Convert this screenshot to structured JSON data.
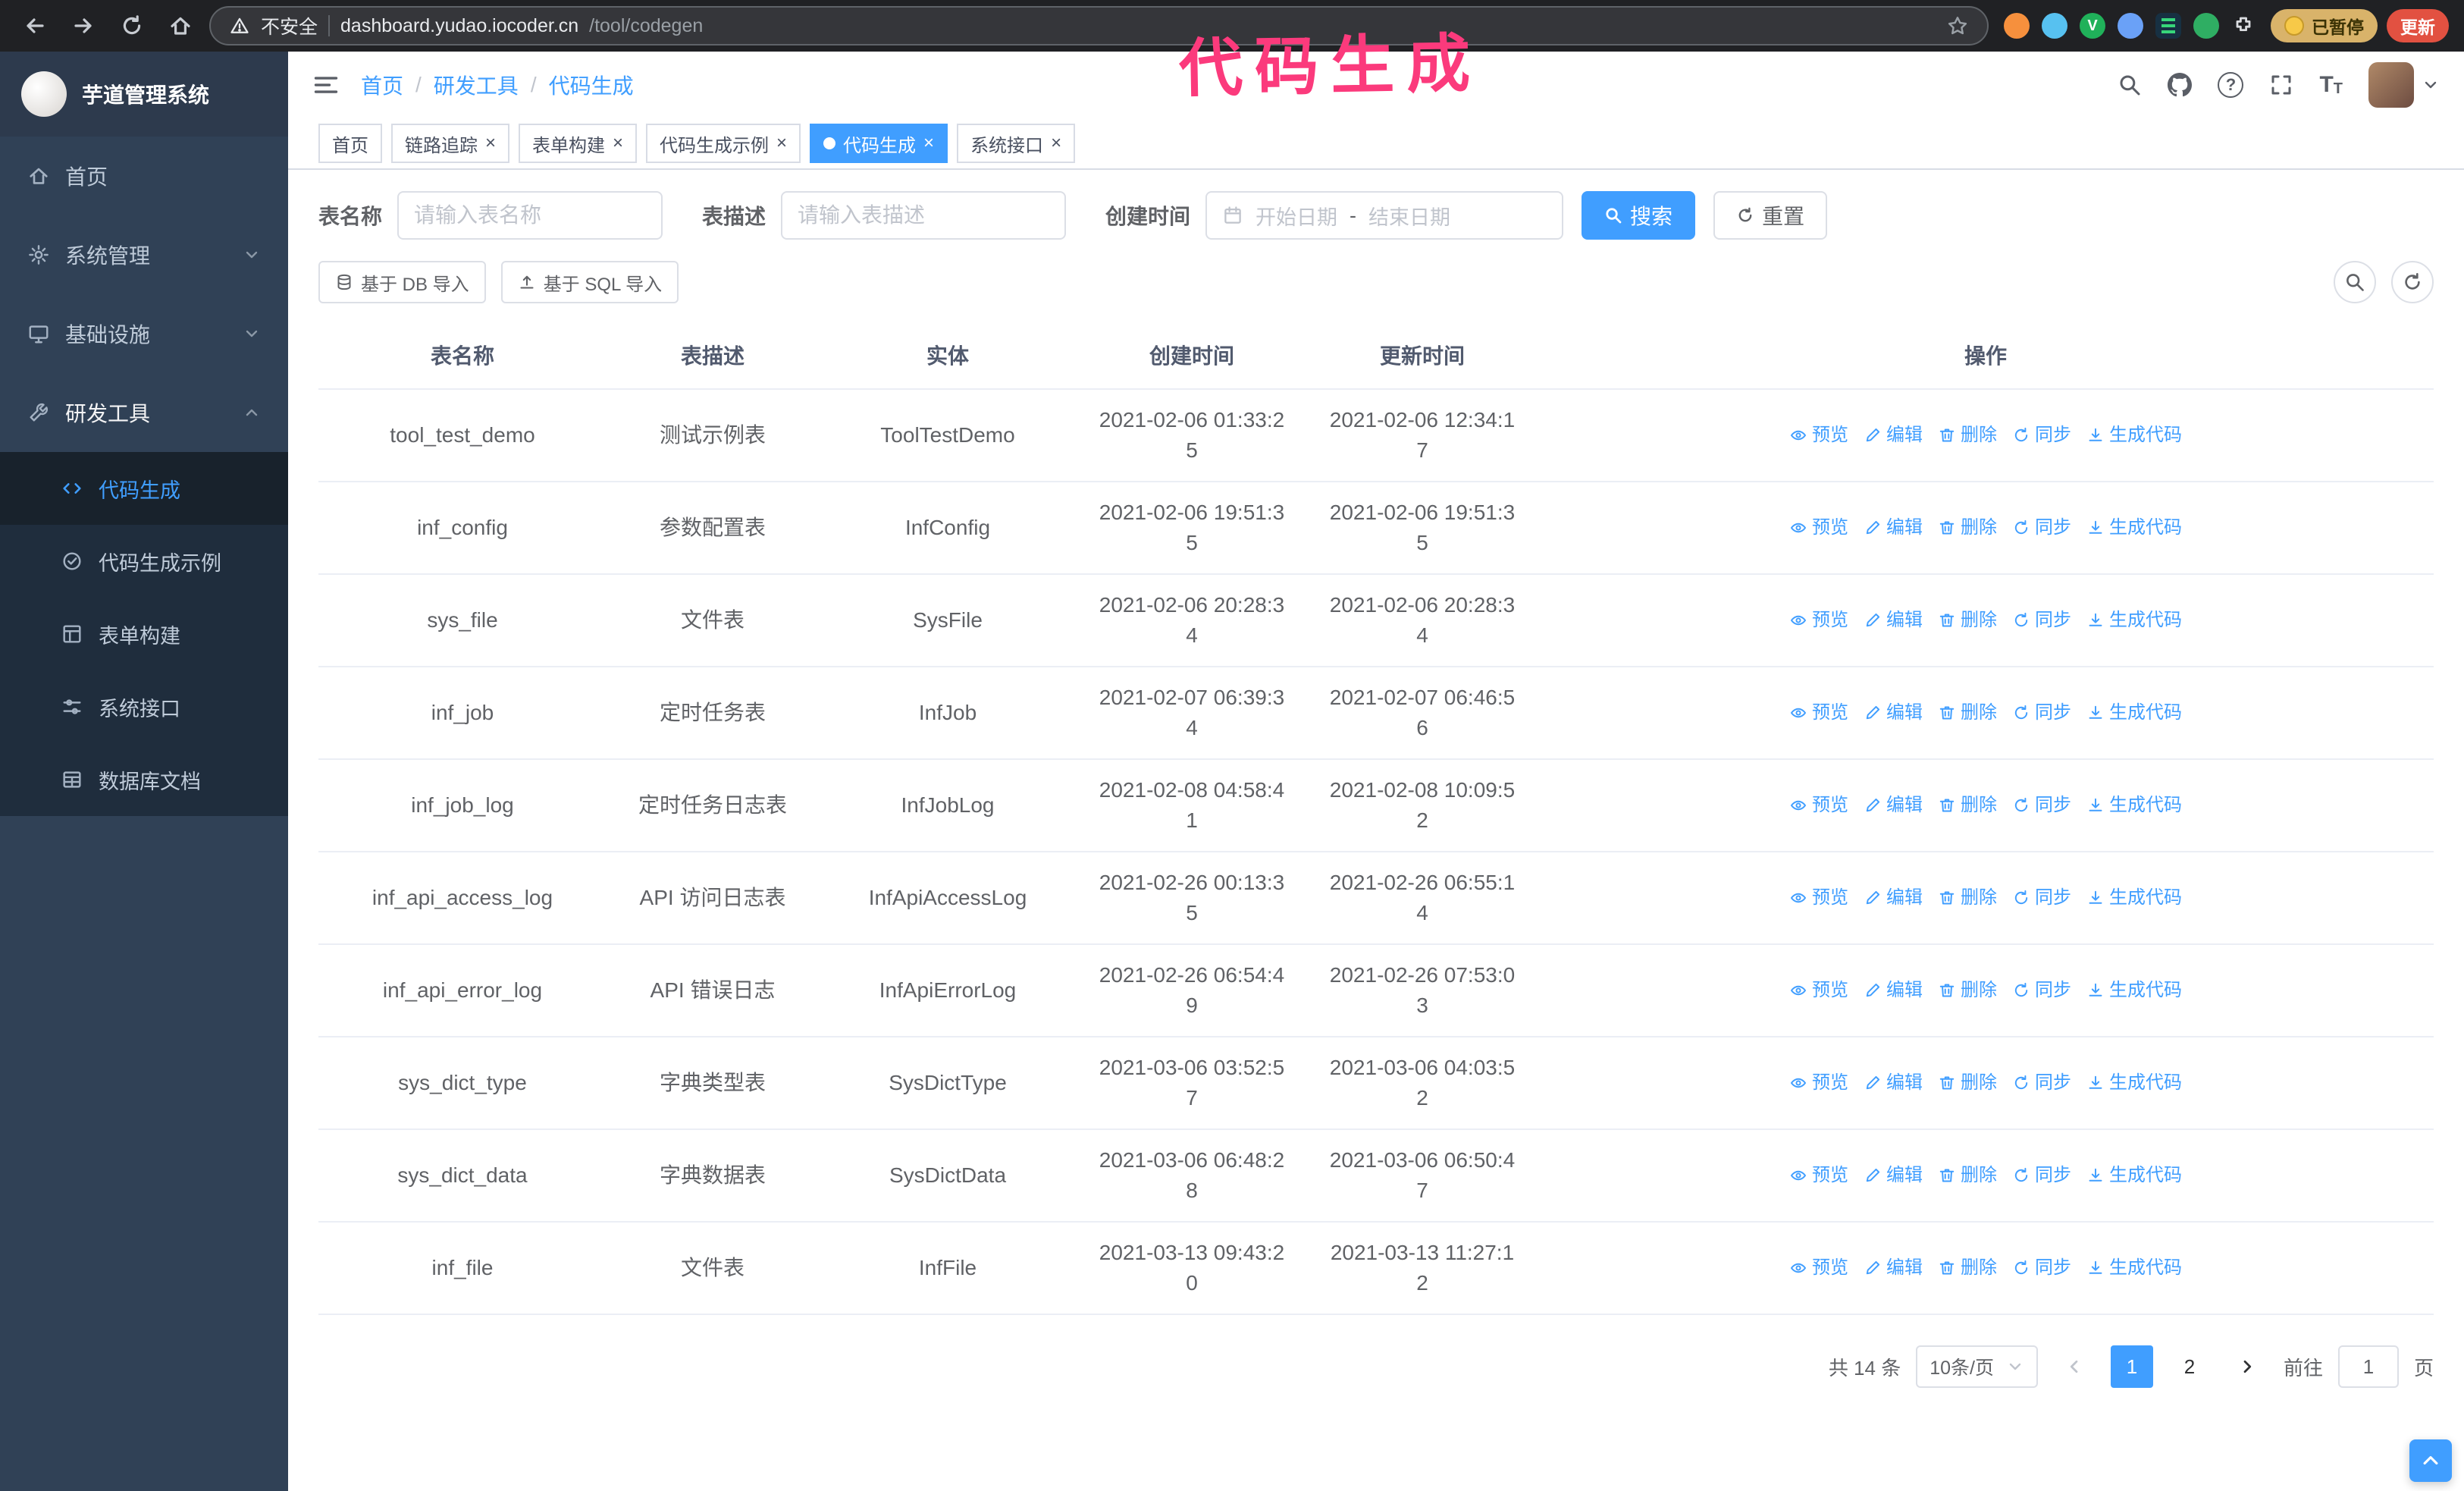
{
  "colors": {
    "accent": "#409eff",
    "sidebar_bg": "#304156",
    "submenu_bg": "#1f2d3d",
    "annotation": "#fb3a7c",
    "chrome_bg": "#202124",
    "update_chip": "#e25141",
    "paused_chip": "#d9b36a"
  },
  "browser": {
    "security_label": "不安全",
    "url_host": "dashboard.yudao.iocoder.cn",
    "url_path": "/tool/codegen",
    "paused_badge_label": "已暂停",
    "update_button_label": "更新"
  },
  "annotation": {
    "text": "代码生成"
  },
  "icons": {
    "close": "×",
    "question": "?",
    "font_size": "T"
  },
  "sidebar": {
    "logo_title": "芋道管理系统",
    "items": [
      {
        "label": "首页"
      },
      {
        "label": "系统管理"
      },
      {
        "label": "基础设施"
      },
      {
        "label": "研发工具"
      }
    ],
    "sub_items": [
      {
        "label": "代码生成"
      },
      {
        "label": "代码生成示例"
      },
      {
        "label": "表单构建"
      },
      {
        "label": "系统接口"
      },
      {
        "label": "数据库文档"
      }
    ]
  },
  "header": {
    "breadcrumb": [
      "首页",
      "研发工具",
      "代码生成"
    ],
    "separator": "/"
  },
  "tabs": [
    {
      "label": "首页"
    },
    {
      "label": "链路追踪"
    },
    {
      "label": "表单构建"
    },
    {
      "label": "代码生成示例"
    },
    {
      "label": "代码生成"
    },
    {
      "label": "系统接口"
    }
  ],
  "filters": {
    "table_name_label": "表名称",
    "table_name_placeholder": "请输入表名称",
    "table_desc_label": "表描述",
    "table_desc_placeholder": "请输入表描述",
    "create_time_label": "创建时间",
    "date_start_placeholder": "开始日期",
    "date_separator": "-",
    "date_end_placeholder": "结束日期",
    "search_button": "搜索",
    "reset_button": "重置"
  },
  "toolbar": {
    "import_db_button": "基于 DB 导入",
    "import_sql_button": "基于 SQL 导入"
  },
  "table": {
    "columns": [
      "表名称",
      "表描述",
      "实体",
      "创建时间",
      "更新时间",
      "操作"
    ],
    "op_labels": [
      "预览",
      "编辑",
      "删除",
      "同步",
      "生成代码"
    ],
    "rows": [
      {
        "name": "tool_test_demo",
        "desc": "测试示例表",
        "entity": "ToolTestDemo",
        "created": "2021-02-06 01:33:25",
        "updated": "2021-02-06 12:34:17"
      },
      {
        "name": "inf_config",
        "desc": "参数配置表",
        "entity": "InfConfig",
        "created": "2021-02-06 19:51:35",
        "updated": "2021-02-06 19:51:35"
      },
      {
        "name": "sys_file",
        "desc": "文件表",
        "entity": "SysFile",
        "created": "2021-02-06 20:28:34",
        "updated": "2021-02-06 20:28:34"
      },
      {
        "name": "inf_job",
        "desc": "定时任务表",
        "entity": "InfJob",
        "created": "2021-02-07 06:39:34",
        "updated": "2021-02-07 06:46:56"
      },
      {
        "name": "inf_job_log",
        "desc": "定时任务日志表",
        "entity": "InfJobLog",
        "created": "2021-02-08 04:58:41",
        "updated": "2021-02-08 10:09:52"
      },
      {
        "name": "inf_api_access_log",
        "desc": "API 访问日志表",
        "entity": "InfApiAccessLog",
        "created": "2021-02-26 00:13:35",
        "updated": "2021-02-26 06:55:14"
      },
      {
        "name": "inf_api_error_log",
        "desc": "API 错误日志",
        "entity": "InfApiErrorLog",
        "created": "2021-02-26 06:54:49",
        "updated": "2021-02-26 07:53:03"
      },
      {
        "name": "sys_dict_type",
        "desc": "字典类型表",
        "entity": "SysDictType",
        "created": "2021-03-06 03:52:57",
        "updated": "2021-03-06 04:03:52"
      },
      {
        "name": "sys_dict_data",
        "desc": "字典数据表",
        "entity": "SysDictData",
        "created": "2021-03-06 06:48:28",
        "updated": "2021-03-06 06:50:47"
      },
      {
        "name": "inf_file",
        "desc": "文件表",
        "entity": "InfFile",
        "created": "2021-03-13 09:43:20",
        "updated": "2021-03-13 11:27:12"
      }
    ]
  },
  "pagination": {
    "total": "共 14 条",
    "page_size": "10条/页",
    "pages": [
      "1",
      "2"
    ],
    "active_page": "1",
    "jump_label": "前往",
    "jump_value": "1",
    "jump_unit": "页"
  }
}
